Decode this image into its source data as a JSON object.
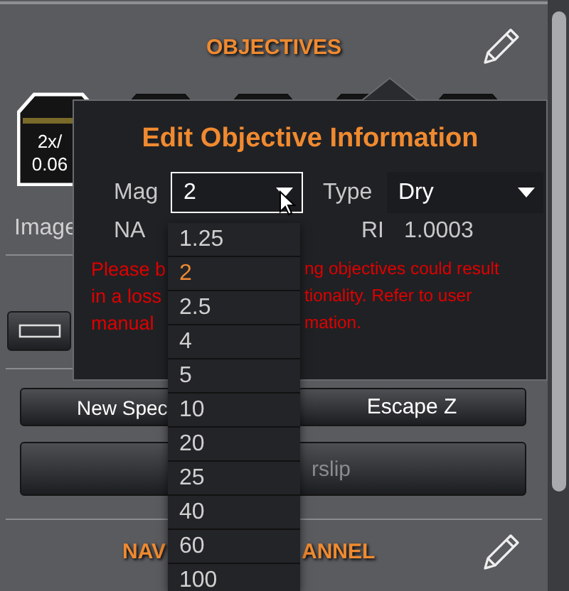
{
  "section": {
    "title": "OBJECTIVES"
  },
  "objectives": [
    {
      "mag": "2x/",
      "na": "0.06",
      "selected": true,
      "color": "#7a6a2a"
    },
    {
      "selected": false
    },
    {
      "selected": false
    },
    {
      "selected": false
    },
    {
      "selected": false
    }
  ],
  "image_field": {
    "label": "Image"
  },
  "dialog": {
    "title": "Edit Objective Information",
    "mag": {
      "label": "Mag",
      "value": "2",
      "open": true
    },
    "type": {
      "label": "Type",
      "value": "Dry"
    },
    "na": {
      "label": "NA"
    },
    "ri": {
      "label": "RI",
      "value": "1.0003"
    },
    "warning": {
      "left_lines": [
        "Please b",
        "in a loss",
        "manual"
      ],
      "right_lines": [
        "ng objectives could result",
        "tionality. Refer to user",
        "mation."
      ]
    }
  },
  "mag_options": [
    {
      "label": "1.25",
      "selected": false
    },
    {
      "label": "2",
      "selected": true
    },
    {
      "label": "2.5",
      "selected": false
    },
    {
      "label": "4",
      "selected": false
    },
    {
      "label": "5",
      "selected": false
    },
    {
      "label": "10",
      "selected": false
    },
    {
      "label": "20",
      "selected": false
    },
    {
      "label": "25",
      "selected": false
    },
    {
      "label": "40",
      "selected": false
    },
    {
      "label": "60",
      "selected": false
    },
    {
      "label": "100",
      "selected": false
    }
  ],
  "buttons": [
    {
      "label": "New Spec"
    },
    {
      "label": "Escape Z"
    }
  ],
  "coverslip_button": {
    "label": "rslip",
    "disabled": true
  },
  "navigation": {
    "left": "NAV",
    "right": "ANNEL"
  }
}
